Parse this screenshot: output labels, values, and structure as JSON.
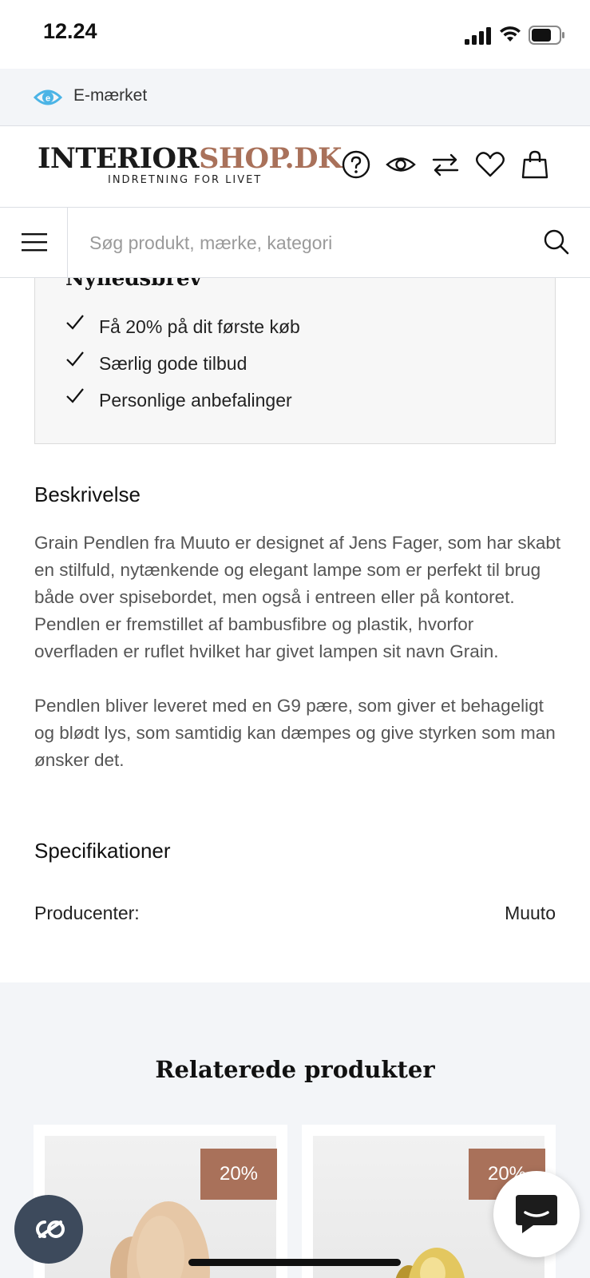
{
  "status_bar": {
    "time": "12.24"
  },
  "emark": {
    "label": "E-mærket",
    "icon": "e-maerket-eye-icon",
    "accent": "#4bb4e6"
  },
  "header": {
    "logo": {
      "part1": "INTERIOR",
      "part2": "SHOP.DK",
      "tagline": "INDRETNING FOR LIVET",
      "brand_color": "#a9715a"
    },
    "icons": [
      "help-icon",
      "eye-icon",
      "compare-icon",
      "heart-icon",
      "bag-icon"
    ]
  },
  "search": {
    "placeholder": "Søg produkt, mærke, kategori"
  },
  "newsletter": {
    "title": "Nyhedsbrev",
    "items": [
      "Få 20% på dit første køb",
      "Særlig gode tilbud",
      "Personlige anbefalinger"
    ]
  },
  "description": {
    "title": "Beskrivelse",
    "paragraphs": [
      "Grain Pendlen fra Muuto er designet af Jens Fager, som har skabt en stilfuld, nytænkende og elegant lampe som er perfekt til brug både over spisebordet, men også i entreen eller på kontoret. Pendlen er fremstillet af bambusfibre og plastik, hvorfor overfladen er ruflet hvilket har givet lampen sit navn Grain.",
      "Pendlen bliver leveret med en G9 pære, som giver et behageligt og blødt lys, som samtidig kan dæmpes og give styrken som man ønsker det."
    ]
  },
  "specifications": {
    "title": "Specifikationer",
    "rows": [
      {
        "key": "Producenter:",
        "value": "Muuto"
      }
    ]
  },
  "related": {
    "title": "Relaterede produkter",
    "products": [
      {
        "badge": "20%"
      },
      {
        "badge": "20%"
      }
    ]
  }
}
